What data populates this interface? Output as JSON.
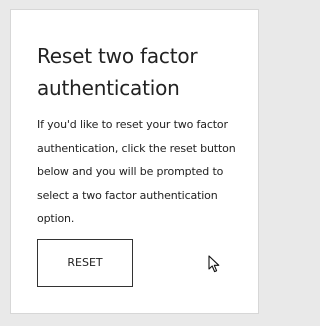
{
  "card": {
    "title": "Reset two factor authentication",
    "description": "If you'd like to reset your two factor authentication, click the reset button below and you will be prompted to select a two factor authentication option.",
    "reset_button_label": "RESET"
  },
  "cursor_icon": "mouse-pointer-icon",
  "colors": {
    "page_background": "#e9e9e9",
    "card_background": "#ffffff",
    "text": "#222222",
    "button_border": "#333333"
  }
}
